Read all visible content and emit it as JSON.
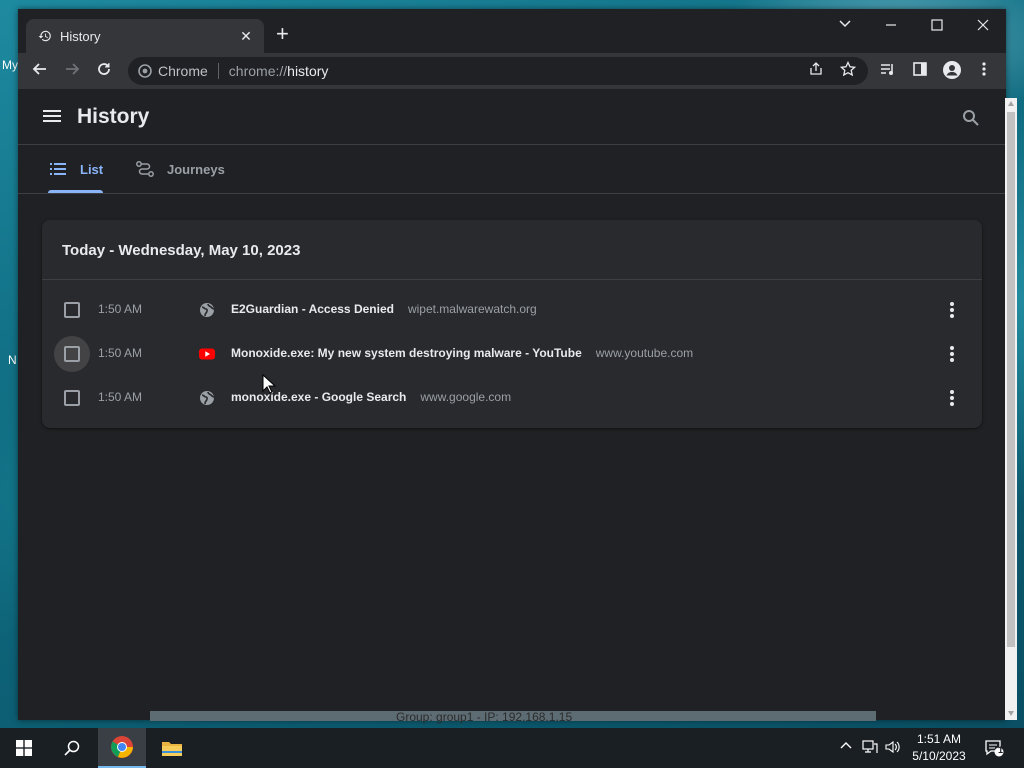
{
  "desktop": {
    "labels": [
      "My",
      "N"
    ]
  },
  "browser": {
    "tab_title": "History",
    "new_tab_label": "+",
    "omnibox": {
      "chip": "Chrome",
      "scheme": "chrome://",
      "host": "history"
    }
  },
  "page": {
    "title": "History",
    "tabs": [
      {
        "label": "List",
        "active": true
      },
      {
        "label": "Journeys",
        "active": false
      }
    ],
    "day_header": "Today - Wednesday, May 10, 2023",
    "entries": [
      {
        "time": "1:50 AM",
        "title": "E2Guardian - Access Denied",
        "domain": "wipet.malwarewatch.org",
        "favicon": "globe-icon"
      },
      {
        "time": "1:50 AM",
        "title": "Monoxide.exe: My new system destroying malware - YouTube",
        "domain": "www.youtube.com",
        "favicon": "youtube-icon"
      },
      {
        "time": "1:50 AM",
        "title": "monoxide.exe - Google Search",
        "domain": "www.google.com",
        "favicon": "globe-icon"
      }
    ]
  },
  "overlay_text": "Group: group1 - IP: 192.168.1.15",
  "taskbar": {
    "time": "1:51 AM",
    "date": "5/10/2023",
    "notification_count": "1"
  },
  "colors": {
    "accent": "#8ab4f8",
    "page_bg": "#202124",
    "card_bg": "#292a2d",
    "youtube_red": "#ff0000"
  }
}
